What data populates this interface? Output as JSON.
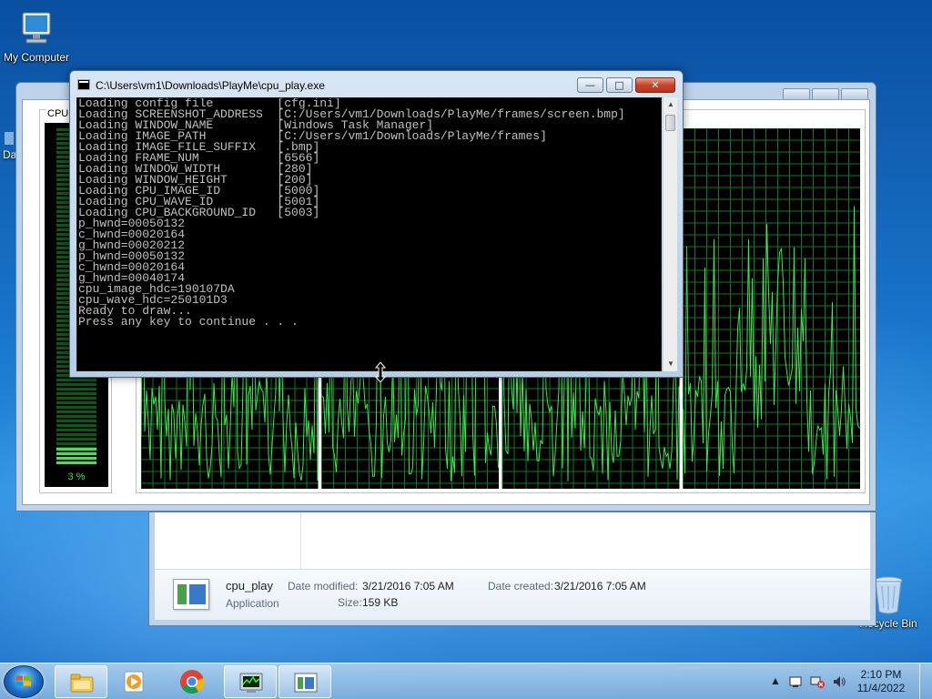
{
  "desktop": {
    "icons": [
      {
        "label": "My Computer"
      },
      {
        "label": "Recycle Bin"
      }
    ],
    "partial_label": "Da"
  },
  "task_manager": {
    "cpu_usage_title": "CPU U",
    "cpu_usage_percent": "3 %",
    "cpu_usage_value": 0.03,
    "graph_color": "#3ee84b",
    "grid_color": "#0d7a28"
  },
  "console": {
    "title": "C:\\Users\\vm1\\Downloads\\PlayMe\\cpu_play.exe",
    "buttons": {
      "minimize": "—",
      "maximize": "□",
      "close": "✕"
    },
    "lines": [
      "Loading config file         [cfg.ini]",
      "Loading SCREENSHOT_ADDRESS  [C:/Users/vm1/Downloads/PlayMe/frames/screen.bmp]",
      "Loading WINDOW_NAME         [Windows Task Manager]",
      "Loading IMAGE_PATH          [C:/Users/vm1/Downloads/PlayMe/frames]",
      "Loading IMAGE_FILE_SUFFIX   [.bmp]",
      "Loading FRAME_NUM           [6566]",
      "Loading WINDOW_WIDTH        [280]",
      "Loading WINDOW_HEIGHT       [200]",
      "Loading CPU_IMAGE_ID        [5000]",
      "Loading CPU_WAVE_ID         [5001]",
      "Loading CPU_BACKGROUND_ID   [5003]",
      "p_hwnd=00050132",
      "c_hwnd=00020164",
      "g_hwnd=00020212",
      "p_hwnd=00050132",
      "c_hwnd=00020164",
      "g_hwnd=00040174",
      "cpu_image_hdc=190107DA",
      "cpu_wave_hdc=250101D3",
      "Ready to draw...",
      "Press any key to continue . . ."
    ]
  },
  "explorer_details": {
    "name": "cpu_play",
    "type": "Application",
    "date_modified_label": "Date modified:",
    "date_modified": "3/21/2016 7:05 AM",
    "date_created_label": "Date created:",
    "date_created": "3/21/2016 7:05 AM",
    "size_label": "Size:",
    "size": "159 KB"
  },
  "taskbar": {
    "items": [
      {
        "icon": "windows-explorer-icon"
      },
      {
        "icon": "media-player-icon"
      },
      {
        "icon": "chrome-icon"
      },
      {
        "icon": "task-manager-icon"
      },
      {
        "icon": "console-app-icon"
      }
    ],
    "clock_time": "2:10 PM",
    "clock_date": "11/4/2022"
  }
}
